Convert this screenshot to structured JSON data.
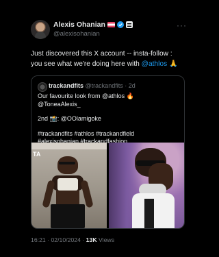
{
  "tweet": {
    "author_name": "Alexis Ohanian",
    "author_handle": "@alexisohanian",
    "text_prefix": "Just discovered this X account -- insta-follow : you see what we're doing here with ",
    "mention": "@athlos",
    "text_suffix": " 🙏",
    "more_label": "···",
    "time": "16:21 · 02/10/2024 · ",
    "views_count": "13K",
    "views_label": " Views"
  },
  "quoted": {
    "author_name": "trackandfits",
    "author_handle": "@trackandfits",
    "age": "· 2d",
    "line1": "Our favourite look from @athlos 🔥 @ToneaAlexis_",
    "line2": "2nd 📸: @OOlamigoke",
    "line3": "#trackandfits #athlos #trackandfield",
    "line4": "#alexisohanian #trackandfashion",
    "image1_text": "TA"
  },
  "colors": {
    "background": "#000000",
    "text": "#e7e9ea",
    "secondary": "#71767b",
    "link": "#1d9bf0",
    "border": "#2f3336"
  }
}
